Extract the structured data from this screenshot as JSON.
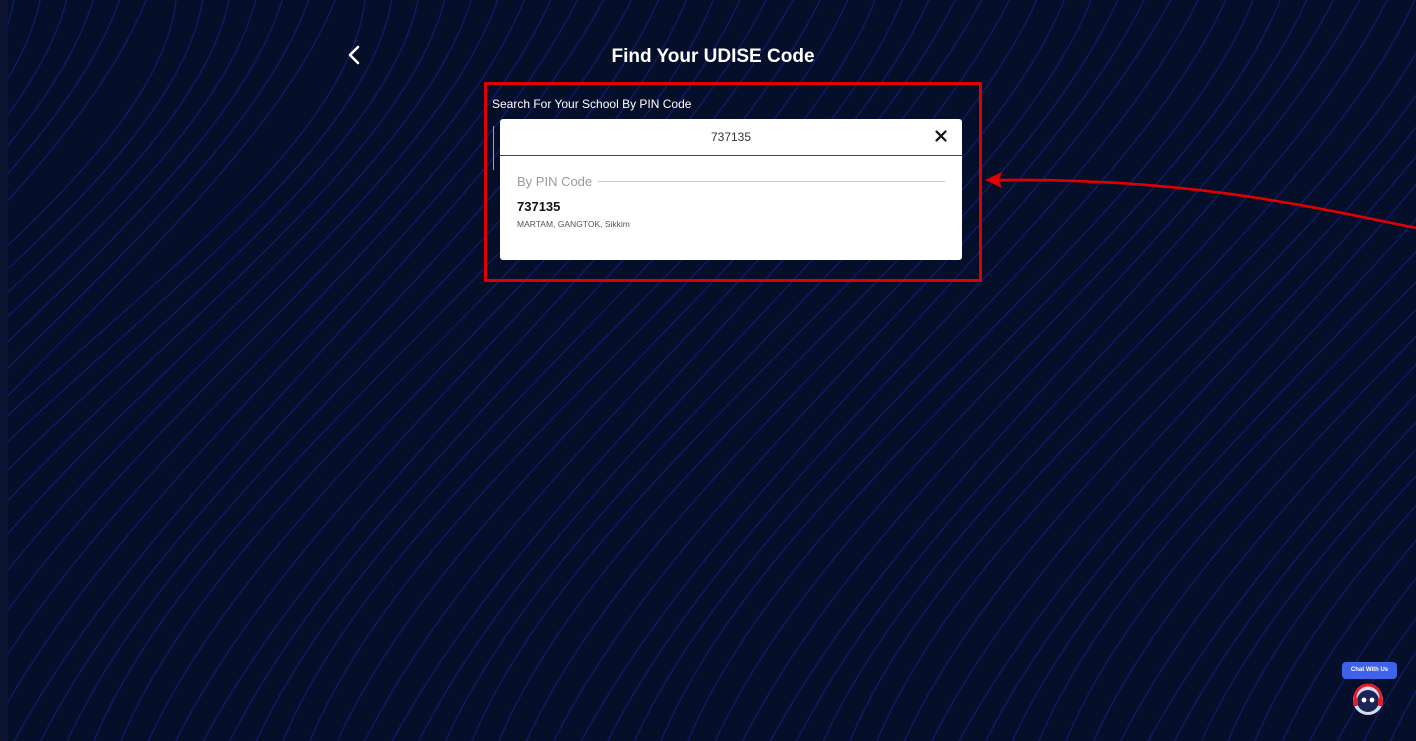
{
  "header": {
    "title": "Find Your UDISE Code"
  },
  "search": {
    "label": "Search For Your School By PIN Code",
    "value": "737135"
  },
  "results": {
    "group_label": "By PIN Code",
    "items": [
      {
        "pin": "737135",
        "location": "MARTAM, GANGTOK, Sikkim"
      }
    ]
  },
  "chat": {
    "label": "Chat With Us"
  },
  "colors": {
    "background": "#050f2a",
    "lines": "#1b2aa8",
    "annotation": "#e00000",
    "chat_accent": "#3f63e8"
  },
  "icons": {
    "back": "chevron-left-icon",
    "clear": "close-icon",
    "chat": "chatbot-avatar-icon"
  }
}
